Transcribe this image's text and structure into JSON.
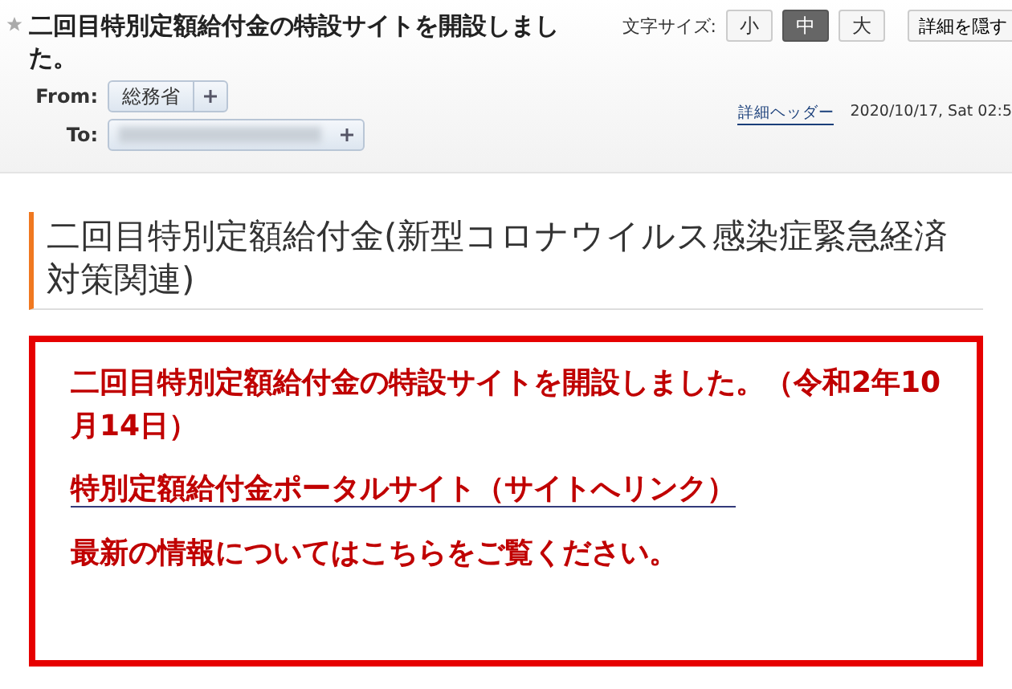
{
  "header": {
    "starred": false,
    "subject": "二回目特別定額給付金の特設サイトを開設しました。",
    "font_size_label": "文字サイズ:",
    "font_sizes": [
      {
        "label": "小",
        "selected": false
      },
      {
        "label": "中",
        "selected": true
      },
      {
        "label": "大",
        "selected": false
      }
    ],
    "hide_details_button": "詳細を隠す",
    "from_label": "From:",
    "from_sender": "総務省",
    "to_label": "To:",
    "details_header_link": "詳細ヘッダー",
    "date": "2020/10/17, Sat 02:5"
  },
  "body": {
    "heading": "二回目特別定額給付金(新型コロナウイルス感染症緊急経済対策関連)",
    "notice": {
      "announcement": "二回目特別定額給付金の特設サイトを開設しました。（令和2年10月14日）",
      "link": "特別定額給付金ポータルサイト（サイトへリンク）",
      "note": "最新の情報についてはこちらをご覧ください。"
    }
  }
}
